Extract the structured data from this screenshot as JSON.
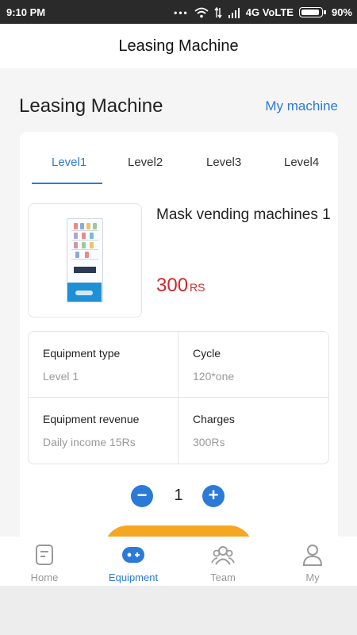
{
  "status_bar": {
    "time": "9:10 PM",
    "network": "4G VoLTE",
    "battery": "90%"
  },
  "header": {
    "title": "Leasing Machine"
  },
  "main": {
    "heading": "Leasing Machine",
    "my_machine_link": "My machine",
    "tabs": [
      {
        "label": "Level1"
      },
      {
        "label": "Level2"
      },
      {
        "label": "Level3"
      },
      {
        "label": "Level4"
      }
    ],
    "product": {
      "name": "Mask vending machines 1",
      "price": "300",
      "currency": "RS"
    },
    "info": {
      "equipment_type_label": "Equipment type",
      "equipment_type_value": "Level 1",
      "cycle_label": "Cycle",
      "cycle_value": "120*one",
      "revenue_label": "Equipment revenue",
      "revenue_value": "Daily income 15Rs",
      "charges_label": "Charges",
      "charges_value": "300Rs"
    },
    "quantity": {
      "value": "1",
      "minus_symbol": "−",
      "plus_symbol": "+"
    }
  },
  "bottom_nav": [
    {
      "label": "Home",
      "icon": "home-icon"
    },
    {
      "label": "Equipment",
      "icon": "equipment-icon"
    },
    {
      "label": "Team",
      "icon": "team-icon"
    },
    {
      "label": "My",
      "icon": "user-icon"
    }
  ],
  "colors": {
    "accent": "#2b7ad8",
    "price": "#d3262b",
    "action_button": "#f5a623",
    "status_bar": "#2a2a2a"
  }
}
